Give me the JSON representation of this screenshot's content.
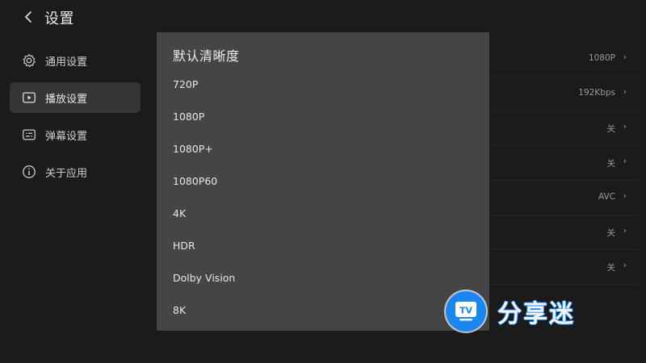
{
  "header": {
    "back_icon": "chevron-left-icon",
    "title": "设置"
  },
  "sidebar": {
    "items": [
      {
        "label": "通用设置",
        "icon": "gear-icon",
        "active": false
      },
      {
        "label": "播放设置",
        "icon": "play-icon",
        "active": true
      },
      {
        "label": "弹幕设置",
        "icon": "danmaku-icon",
        "active": false
      },
      {
        "label": "关于应用",
        "icon": "info-icon",
        "active": false
      }
    ]
  },
  "settings": {
    "rows": [
      {
        "value": "1080P"
      },
      {
        "value": "192Kbps"
      },
      {
        "value": "关"
      },
      {
        "value": "关"
      },
      {
        "value": "AVC"
      },
      {
        "value": "关"
      },
      {
        "value": "关"
      }
    ],
    "chevron_icon": "chevron-right-icon"
  },
  "modal": {
    "title": "默认清晰度",
    "options": [
      "720P",
      "1080P",
      "1080P+",
      "1080P60",
      "4K",
      "HDR",
      "Dolby Vision",
      "8K"
    ]
  },
  "watermark": {
    "badge_text": "TV",
    "text": "分享迷",
    "color": "#1a86f0"
  }
}
